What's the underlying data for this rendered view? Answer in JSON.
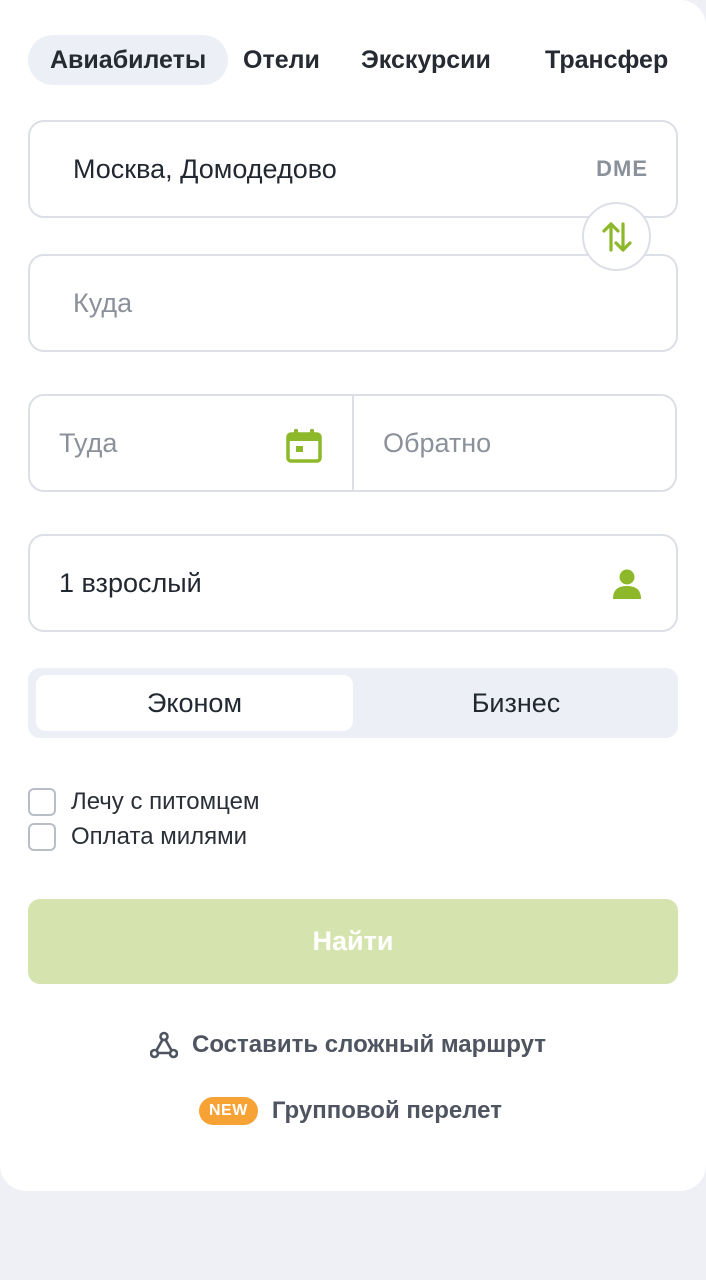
{
  "tabs": [
    {
      "label": "Авиабилеты",
      "active": true
    },
    {
      "label": "Отели",
      "active": false
    },
    {
      "label": "Экскурсии",
      "active": false
    },
    {
      "label": "Трансфер",
      "active": false
    }
  ],
  "from": {
    "value": "Москва, Домодедово",
    "code": "DME"
  },
  "to": {
    "placeholder": "Куда"
  },
  "dates": {
    "depart_placeholder": "Туда",
    "return_placeholder": "Обратно"
  },
  "passengers": {
    "value": "1 взрослый"
  },
  "cabin_class": {
    "options": [
      "Эконом",
      "Бизнес"
    ],
    "selected": "Эконом"
  },
  "options": [
    {
      "label": "Лечу с питомцем",
      "checked": false
    },
    {
      "label": "Оплата милями",
      "checked": false
    }
  ],
  "search_button": {
    "label": "Найти"
  },
  "complex_route": {
    "label": "Составить сложный маршрут"
  },
  "group_flight": {
    "badge": "NEW",
    "label": "Групповой перелет"
  },
  "colors": {
    "accent": "#8cb82a",
    "badge": "#f7a234",
    "button_disabled": "#d5e4ae"
  },
  "icons": {
    "swap": "swap-vertical-icon",
    "calendar": "calendar-icon",
    "person": "person-icon",
    "route": "route-icon"
  }
}
